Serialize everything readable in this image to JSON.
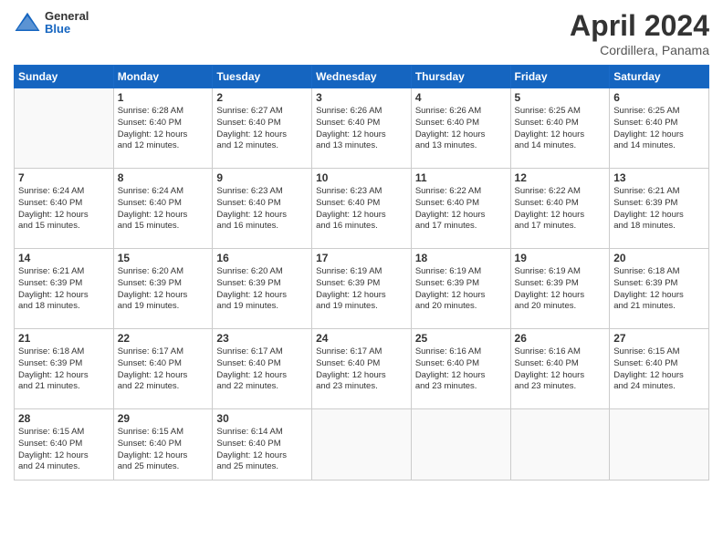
{
  "header": {
    "logo": {
      "line1": "General",
      "line2": "Blue"
    },
    "title": "April 2024",
    "subtitle": "Cordillera, Panama"
  },
  "days_of_week": [
    "Sunday",
    "Monday",
    "Tuesday",
    "Wednesday",
    "Thursday",
    "Friday",
    "Saturday"
  ],
  "weeks": [
    [
      {
        "day": "",
        "info": ""
      },
      {
        "day": "1",
        "info": "Sunrise: 6:28 AM\nSunset: 6:40 PM\nDaylight: 12 hours\nand 12 minutes."
      },
      {
        "day": "2",
        "info": "Sunrise: 6:27 AM\nSunset: 6:40 PM\nDaylight: 12 hours\nand 12 minutes."
      },
      {
        "day": "3",
        "info": "Sunrise: 6:26 AM\nSunset: 6:40 PM\nDaylight: 12 hours\nand 13 minutes."
      },
      {
        "day": "4",
        "info": "Sunrise: 6:26 AM\nSunset: 6:40 PM\nDaylight: 12 hours\nand 13 minutes."
      },
      {
        "day": "5",
        "info": "Sunrise: 6:25 AM\nSunset: 6:40 PM\nDaylight: 12 hours\nand 14 minutes."
      },
      {
        "day": "6",
        "info": "Sunrise: 6:25 AM\nSunset: 6:40 PM\nDaylight: 12 hours\nand 14 minutes."
      }
    ],
    [
      {
        "day": "7",
        "info": "Sunrise: 6:24 AM\nSunset: 6:40 PM\nDaylight: 12 hours\nand 15 minutes."
      },
      {
        "day": "8",
        "info": "Sunrise: 6:24 AM\nSunset: 6:40 PM\nDaylight: 12 hours\nand 15 minutes."
      },
      {
        "day": "9",
        "info": "Sunrise: 6:23 AM\nSunset: 6:40 PM\nDaylight: 12 hours\nand 16 minutes."
      },
      {
        "day": "10",
        "info": "Sunrise: 6:23 AM\nSunset: 6:40 PM\nDaylight: 12 hours\nand 16 minutes."
      },
      {
        "day": "11",
        "info": "Sunrise: 6:22 AM\nSunset: 6:40 PM\nDaylight: 12 hours\nand 17 minutes."
      },
      {
        "day": "12",
        "info": "Sunrise: 6:22 AM\nSunset: 6:40 PM\nDaylight: 12 hours\nand 17 minutes."
      },
      {
        "day": "13",
        "info": "Sunrise: 6:21 AM\nSunset: 6:39 PM\nDaylight: 12 hours\nand 18 minutes."
      }
    ],
    [
      {
        "day": "14",
        "info": "Sunrise: 6:21 AM\nSunset: 6:39 PM\nDaylight: 12 hours\nand 18 minutes."
      },
      {
        "day": "15",
        "info": "Sunrise: 6:20 AM\nSunset: 6:39 PM\nDaylight: 12 hours\nand 19 minutes."
      },
      {
        "day": "16",
        "info": "Sunrise: 6:20 AM\nSunset: 6:39 PM\nDaylight: 12 hours\nand 19 minutes."
      },
      {
        "day": "17",
        "info": "Sunrise: 6:19 AM\nSunset: 6:39 PM\nDaylight: 12 hours\nand 19 minutes."
      },
      {
        "day": "18",
        "info": "Sunrise: 6:19 AM\nSunset: 6:39 PM\nDaylight: 12 hours\nand 20 minutes."
      },
      {
        "day": "19",
        "info": "Sunrise: 6:19 AM\nSunset: 6:39 PM\nDaylight: 12 hours\nand 20 minutes."
      },
      {
        "day": "20",
        "info": "Sunrise: 6:18 AM\nSunset: 6:39 PM\nDaylight: 12 hours\nand 21 minutes."
      }
    ],
    [
      {
        "day": "21",
        "info": "Sunrise: 6:18 AM\nSunset: 6:39 PM\nDaylight: 12 hours\nand 21 minutes."
      },
      {
        "day": "22",
        "info": "Sunrise: 6:17 AM\nSunset: 6:40 PM\nDaylight: 12 hours\nand 22 minutes."
      },
      {
        "day": "23",
        "info": "Sunrise: 6:17 AM\nSunset: 6:40 PM\nDaylight: 12 hours\nand 22 minutes."
      },
      {
        "day": "24",
        "info": "Sunrise: 6:17 AM\nSunset: 6:40 PM\nDaylight: 12 hours\nand 23 minutes."
      },
      {
        "day": "25",
        "info": "Sunrise: 6:16 AM\nSunset: 6:40 PM\nDaylight: 12 hours\nand 23 minutes."
      },
      {
        "day": "26",
        "info": "Sunrise: 6:16 AM\nSunset: 6:40 PM\nDaylight: 12 hours\nand 23 minutes."
      },
      {
        "day": "27",
        "info": "Sunrise: 6:15 AM\nSunset: 6:40 PM\nDaylight: 12 hours\nand 24 minutes."
      }
    ],
    [
      {
        "day": "28",
        "info": "Sunrise: 6:15 AM\nSunset: 6:40 PM\nDaylight: 12 hours\nand 24 minutes."
      },
      {
        "day": "29",
        "info": "Sunrise: 6:15 AM\nSunset: 6:40 PM\nDaylight: 12 hours\nand 25 minutes."
      },
      {
        "day": "30",
        "info": "Sunrise: 6:14 AM\nSunset: 6:40 PM\nDaylight: 12 hours\nand 25 minutes."
      },
      {
        "day": "",
        "info": ""
      },
      {
        "day": "",
        "info": ""
      },
      {
        "day": "",
        "info": ""
      },
      {
        "day": "",
        "info": ""
      }
    ]
  ]
}
